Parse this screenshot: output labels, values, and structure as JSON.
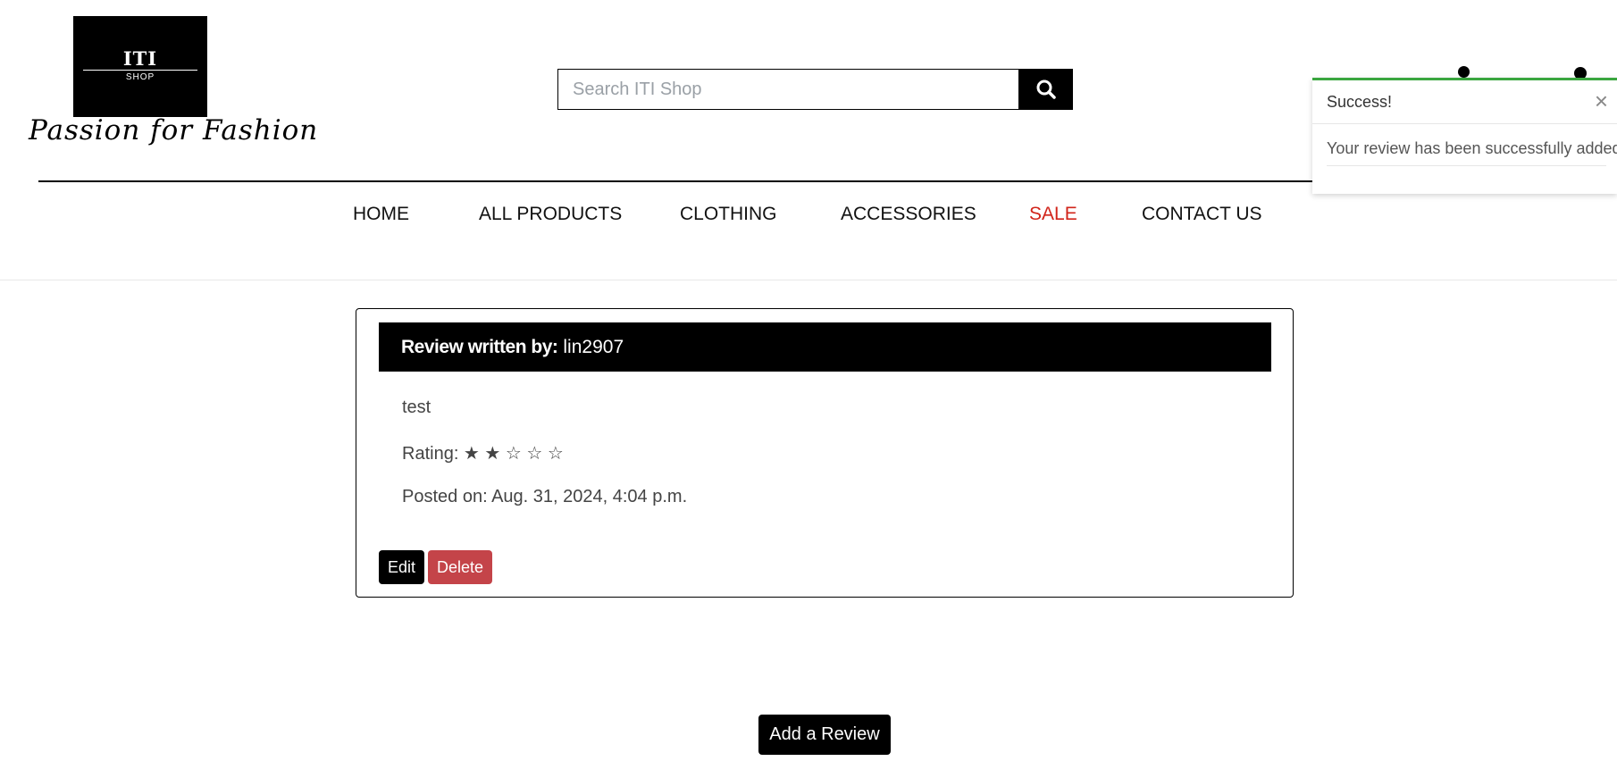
{
  "logo": {
    "main": "ITI",
    "sub": "SHOP",
    "tagline": "Passion for Fashion"
  },
  "search": {
    "placeholder": "Search ITI Shop",
    "value": ""
  },
  "nav": {
    "items": [
      {
        "label": "HOME"
      },
      {
        "label": "ALL PRODUCTS"
      },
      {
        "label": "CLOTHING"
      },
      {
        "label": "ACCESSORIES"
      },
      {
        "label": "SALE"
      },
      {
        "label": "CONTACT US"
      }
    ],
    "sale_color": "#d1241a"
  },
  "toast": {
    "title": "Success!",
    "close": "×",
    "message": "Your review has been successfully added!",
    "accent": "#3aa63f"
  },
  "review": {
    "header_label": "Review written by:",
    "author": "lin2907",
    "body": "test",
    "rating_text": "Rating: ★ ★ ☆ ☆ ☆",
    "rating_value": 2,
    "rating_max": 5,
    "posted": "Posted on: Aug. 31, 2024, 4:04 p.m.",
    "edit_label": "Edit",
    "delete_label": "Delete",
    "delete_color": "#c44449"
  },
  "add_review_label": "Add a Review",
  "icons": {
    "search": "search-icon",
    "account": "account-icon",
    "bag": "shopping-bag-icon",
    "close": "close-icon"
  }
}
